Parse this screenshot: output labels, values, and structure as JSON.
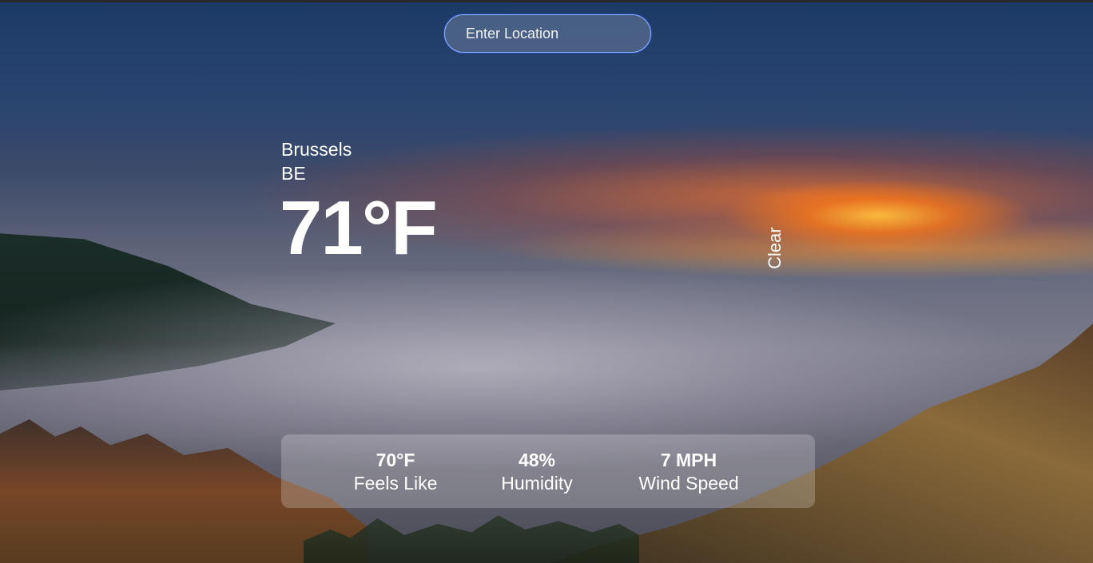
{
  "search": {
    "placeholder": "Enter Location"
  },
  "location": {
    "city": "Brussels",
    "country": "BE"
  },
  "weather": {
    "temperature": "71°F",
    "condition": "Clear"
  },
  "stats": {
    "feels_like": {
      "value": "70°F",
      "label": "Feels Like"
    },
    "humidity": {
      "value": "48%",
      "label": "Humidity"
    },
    "wind": {
      "value": "7 MPH",
      "label": "Wind Speed"
    }
  },
  "colors": {
    "search_border": "#8fb4ff",
    "text": "#ffffff"
  },
  "background": {
    "description_icon": "landscape-background-image"
  }
}
